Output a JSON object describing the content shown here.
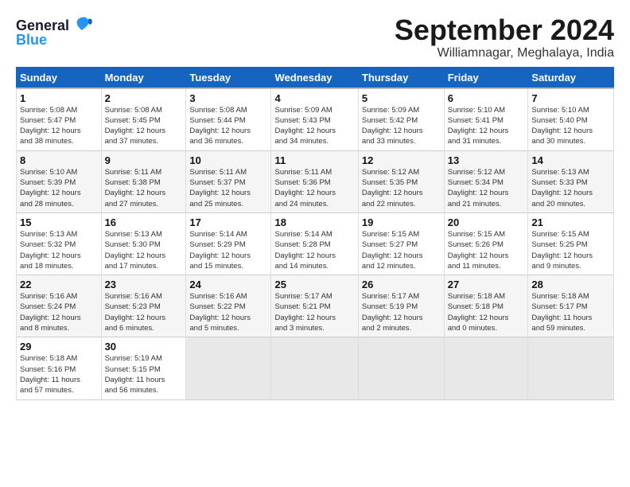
{
  "logo": {
    "line1": "General",
    "line2": "Blue"
  },
  "title": "September 2024",
  "subtitle": "Williamnagar, Meghalaya, India",
  "headers": [
    "Sunday",
    "Monday",
    "Tuesday",
    "Wednesday",
    "Thursday",
    "Friday",
    "Saturday"
  ],
  "weeks": [
    [
      {
        "num": "1",
        "info": "Sunrise: 5:08 AM\nSunset: 5:47 PM\nDaylight: 12 hours\nand 38 minutes."
      },
      {
        "num": "2",
        "info": "Sunrise: 5:08 AM\nSunset: 5:45 PM\nDaylight: 12 hours\nand 37 minutes."
      },
      {
        "num": "3",
        "info": "Sunrise: 5:08 AM\nSunset: 5:44 PM\nDaylight: 12 hours\nand 36 minutes."
      },
      {
        "num": "4",
        "info": "Sunrise: 5:09 AM\nSunset: 5:43 PM\nDaylight: 12 hours\nand 34 minutes."
      },
      {
        "num": "5",
        "info": "Sunrise: 5:09 AM\nSunset: 5:42 PM\nDaylight: 12 hours\nand 33 minutes."
      },
      {
        "num": "6",
        "info": "Sunrise: 5:10 AM\nSunset: 5:41 PM\nDaylight: 12 hours\nand 31 minutes."
      },
      {
        "num": "7",
        "info": "Sunrise: 5:10 AM\nSunset: 5:40 PM\nDaylight: 12 hours\nand 30 minutes."
      }
    ],
    [
      {
        "num": "8",
        "info": "Sunrise: 5:10 AM\nSunset: 5:39 PM\nDaylight: 12 hours\nand 28 minutes."
      },
      {
        "num": "9",
        "info": "Sunrise: 5:11 AM\nSunset: 5:38 PM\nDaylight: 12 hours\nand 27 minutes."
      },
      {
        "num": "10",
        "info": "Sunrise: 5:11 AM\nSunset: 5:37 PM\nDaylight: 12 hours\nand 25 minutes."
      },
      {
        "num": "11",
        "info": "Sunrise: 5:11 AM\nSunset: 5:36 PM\nDaylight: 12 hours\nand 24 minutes."
      },
      {
        "num": "12",
        "info": "Sunrise: 5:12 AM\nSunset: 5:35 PM\nDaylight: 12 hours\nand 22 minutes."
      },
      {
        "num": "13",
        "info": "Sunrise: 5:12 AM\nSunset: 5:34 PM\nDaylight: 12 hours\nand 21 minutes."
      },
      {
        "num": "14",
        "info": "Sunrise: 5:13 AM\nSunset: 5:33 PM\nDaylight: 12 hours\nand 20 minutes."
      }
    ],
    [
      {
        "num": "15",
        "info": "Sunrise: 5:13 AM\nSunset: 5:32 PM\nDaylight: 12 hours\nand 18 minutes."
      },
      {
        "num": "16",
        "info": "Sunrise: 5:13 AM\nSunset: 5:30 PM\nDaylight: 12 hours\nand 17 minutes."
      },
      {
        "num": "17",
        "info": "Sunrise: 5:14 AM\nSunset: 5:29 PM\nDaylight: 12 hours\nand 15 minutes."
      },
      {
        "num": "18",
        "info": "Sunrise: 5:14 AM\nSunset: 5:28 PM\nDaylight: 12 hours\nand 14 minutes."
      },
      {
        "num": "19",
        "info": "Sunrise: 5:15 AM\nSunset: 5:27 PM\nDaylight: 12 hours\nand 12 minutes."
      },
      {
        "num": "20",
        "info": "Sunrise: 5:15 AM\nSunset: 5:26 PM\nDaylight: 12 hours\nand 11 minutes."
      },
      {
        "num": "21",
        "info": "Sunrise: 5:15 AM\nSunset: 5:25 PM\nDaylight: 12 hours\nand 9 minutes."
      }
    ],
    [
      {
        "num": "22",
        "info": "Sunrise: 5:16 AM\nSunset: 5:24 PM\nDaylight: 12 hours\nand 8 minutes."
      },
      {
        "num": "23",
        "info": "Sunrise: 5:16 AM\nSunset: 5:23 PM\nDaylight: 12 hours\nand 6 minutes."
      },
      {
        "num": "24",
        "info": "Sunrise: 5:16 AM\nSunset: 5:22 PM\nDaylight: 12 hours\nand 5 minutes."
      },
      {
        "num": "25",
        "info": "Sunrise: 5:17 AM\nSunset: 5:21 PM\nDaylight: 12 hours\nand 3 minutes."
      },
      {
        "num": "26",
        "info": "Sunrise: 5:17 AM\nSunset: 5:19 PM\nDaylight: 12 hours\nand 2 minutes."
      },
      {
        "num": "27",
        "info": "Sunrise: 5:18 AM\nSunset: 5:18 PM\nDaylight: 12 hours\nand 0 minutes."
      },
      {
        "num": "28",
        "info": "Sunrise: 5:18 AM\nSunset: 5:17 PM\nDaylight: 11 hours\nand 59 minutes."
      }
    ],
    [
      {
        "num": "29",
        "info": "Sunrise: 5:18 AM\nSunset: 5:16 PM\nDaylight: 11 hours\nand 57 minutes."
      },
      {
        "num": "30",
        "info": "Sunrise: 5:19 AM\nSunset: 5:15 PM\nDaylight: 11 hours\nand 56 minutes."
      },
      {
        "num": "",
        "info": ""
      },
      {
        "num": "",
        "info": ""
      },
      {
        "num": "",
        "info": ""
      },
      {
        "num": "",
        "info": ""
      },
      {
        "num": "",
        "info": ""
      }
    ]
  ]
}
